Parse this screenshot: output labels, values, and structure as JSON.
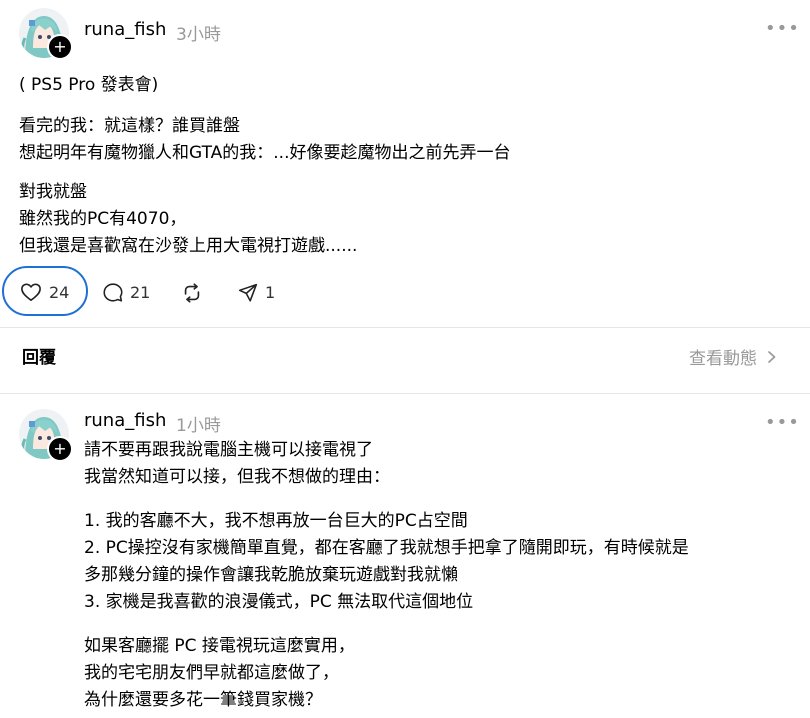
{
  "post1": {
    "username": "runa_fish",
    "time": "3小時",
    "more_icon": "more-dots-icon",
    "lines_a": [
      "( PS5 Pro 發表會)"
    ],
    "lines_b": [
      "看完的我：就這樣？誰買誰盤",
      "想起明年有魔物獵人和GTA的我：...好像要趁魔物出之前先弄一台"
    ],
    "lines_c": [
      "對我就盤",
      "雖然我的PC有4070，",
      "但我還是喜歡窩在沙發上用大電視打遊戲......"
    ],
    "actions": {
      "like_count": "24",
      "reply_count": "21",
      "share_count": "1"
    }
  },
  "replies_bar": {
    "label": "回覆",
    "activity_label": "查看動態",
    "activity_icon": "chevron-right-icon"
  },
  "post2": {
    "username": "runa_fish",
    "time": "1小時",
    "more_icon": "more-dots-icon",
    "lines_a": [
      "請不要再跟我說電腦主機可以接電視了",
      "我當然知道可以接，但我不想做的理由："
    ],
    "lines_b": [
      "1. 我的客廳不大，我不想再放一台巨大的PC占空間",
      "2. PC操控沒有家機簡單直覺，都在客廳了我就想手把拿了隨開即玩，有時候就是",
      "多那幾分鐘的操作會讓我乾脆放棄玩遊戲對我就懶",
      "3. 家機是我喜歡的浪漫儀式，PC 無法取代這個地位"
    ],
    "lines_c": [
      "如果客廳擺 PC 接電視玩這麼實用，",
      "我的宅宅朋友們早就都這麼做了，",
      "為什麼還要多花一筆錢買家機？"
    ]
  },
  "colors": {
    "highlight_ring": "#1f6fd6",
    "muted": "#999999",
    "divider": "#e6e6e6"
  }
}
